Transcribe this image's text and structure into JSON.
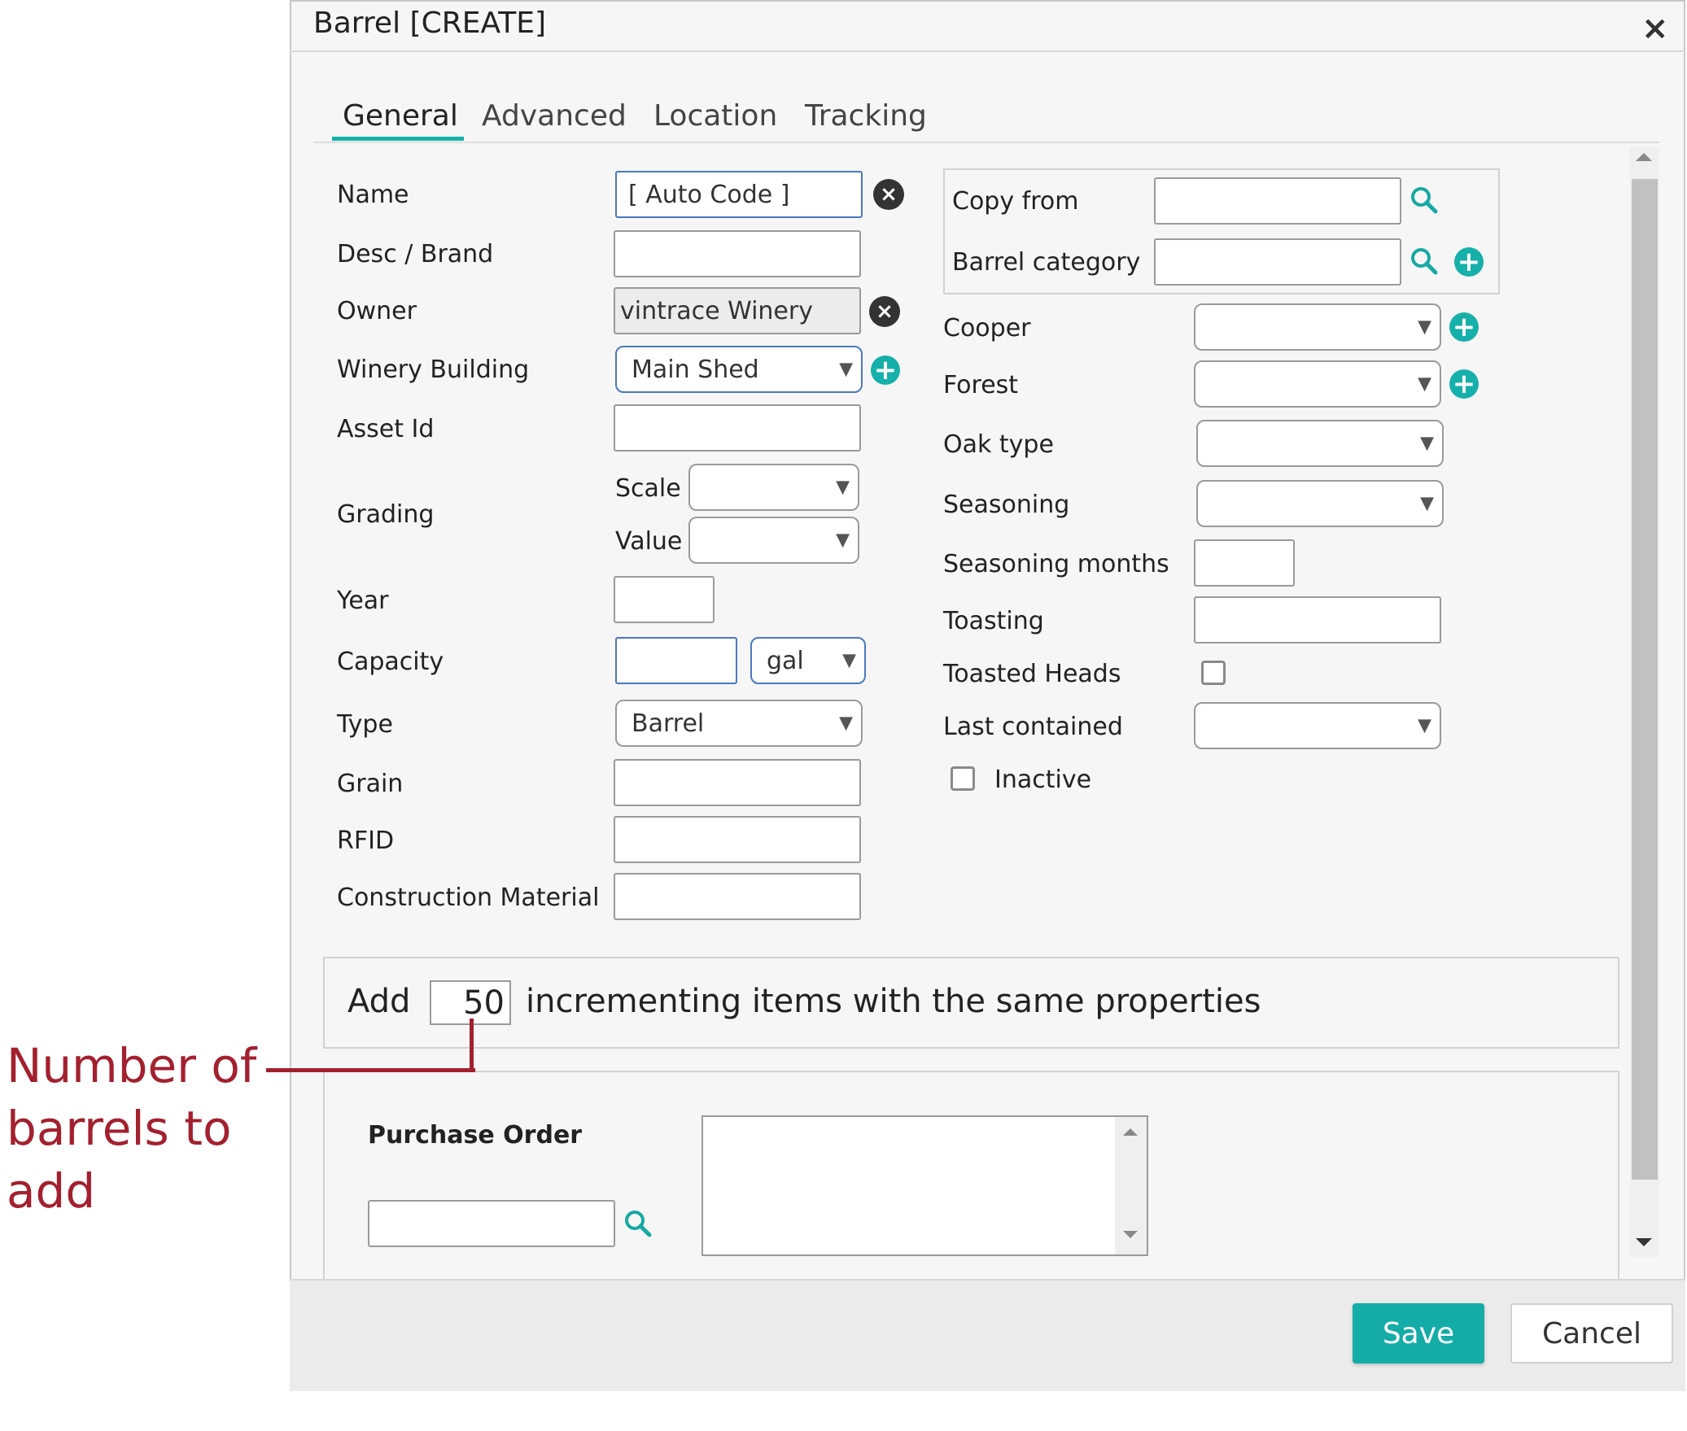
{
  "dialog": {
    "title": "Barrel [CREATE]",
    "close_icon": "×"
  },
  "tabs": [
    "General",
    "Advanced",
    "Location",
    "Tracking"
  ],
  "left": {
    "name_label": "Name",
    "name_value": "[ Auto Code ]",
    "desc_label": "Desc / Brand",
    "owner_label": "Owner",
    "owner_value": "vintrace Winery",
    "building_label": "Winery Building",
    "building_value": "Main Shed",
    "asset_label": "Asset Id",
    "grading_label": "Grading",
    "scale_label": "Scale",
    "value_label": "Value",
    "year_label": "Year",
    "capacity_label": "Capacity",
    "capacity_unit": "gal",
    "type_label": "Type",
    "type_value": "Barrel",
    "grain_label": "Grain",
    "rfid_label": "RFID",
    "construction_label": "Construction Material"
  },
  "right": {
    "copy_from_label": "Copy from",
    "barrel_category_label": "Barrel category",
    "cooper_label": "Cooper",
    "forest_label": "Forest",
    "oak_label": "Oak type",
    "seasoning_label": "Seasoning",
    "seasoning_months_label": "Seasoning months",
    "toasting_label": "Toasting",
    "toasted_heads_label": "Toasted Heads",
    "last_contained_label": "Last contained",
    "inactive_label": "Inactive"
  },
  "add_row": {
    "prefix": "Add",
    "count": "50",
    "suffix": "incrementing items with the same properties"
  },
  "purchase_order": {
    "label": "Purchase Order"
  },
  "footer": {
    "save_label": "Save",
    "cancel_label": "Cancel"
  },
  "annotation": {
    "line1": "Number of",
    "line2": "barrels to",
    "line3": "add"
  },
  "colors": {
    "accent": "#14aca6",
    "annotation": "#a3202e",
    "field_focus": "#4a78c2"
  }
}
